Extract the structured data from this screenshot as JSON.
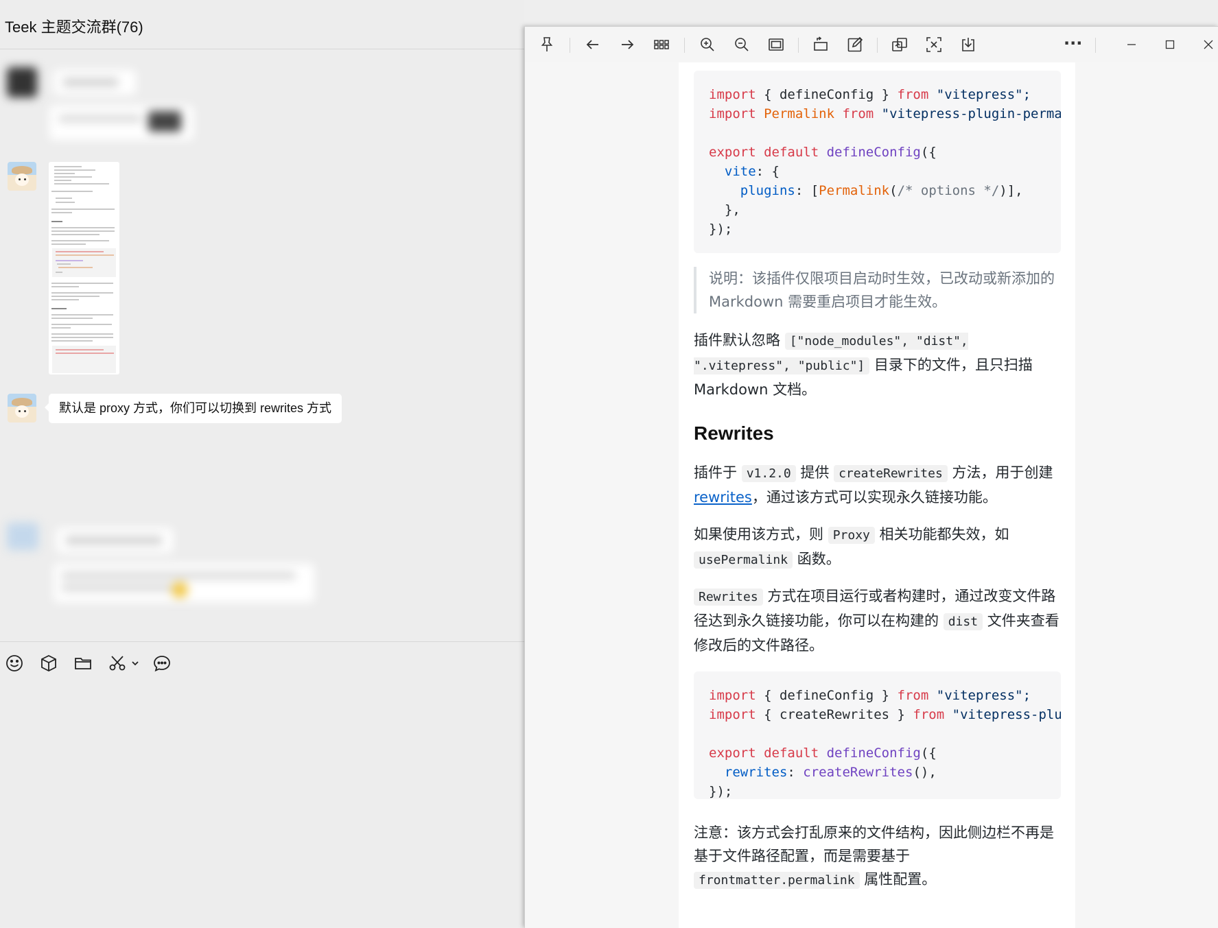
{
  "chat": {
    "title": "Teek 主题交流群(76)",
    "message_text": "默认是 proxy 方式，你们可以切换到 rewrites 方式",
    "toolbar": {
      "icons": [
        "emoji-icon",
        "box-icon",
        "folder-icon",
        "scissors-icon",
        "chevron-down-icon",
        "chat-bubble-icon"
      ]
    }
  },
  "viewer": {
    "toolbar_icons": [
      "pin-icon",
      "arrow-left-icon",
      "arrow-right-icon",
      "grid-icon",
      "zoom-in-icon",
      "zoom-out-icon",
      "fit-screen-icon",
      "rotate-icon",
      "edit-icon",
      "copy-icon",
      "scan-icon",
      "download-icon",
      "more-icon",
      "minimize-icon",
      "maximize-icon",
      "close-icon"
    ],
    "more_glyph": "···",
    "doc": {
      "code1": {
        "l1": {
          "kw": "import",
          "a": " { defineConfig } ",
          "kw2": "from",
          "s": " \"vitepress\";"
        },
        "l2": {
          "kw": "import",
          "cls": " Permalink",
          "kw2": " from",
          "s": " \"vitepress-plugin-perma"
        },
        "l3": {
          "kw": "export default",
          "fn": " defineConfig",
          "rest": "({"
        },
        "l4": {
          "prop": "  vite",
          "rest": ": {"
        },
        "l5": {
          "prop": "    plugins",
          "a": ": [",
          "cls": "Permalink",
          "b": "(",
          "cm": "/* options */",
          "c": ")],"
        },
        "l6": "  },",
        "l7": "});"
      },
      "note": "说明：该插件仅限项目启动时生效，已改动或新添加的 Markdown 需要重启项目才能生效。",
      "p1": {
        "a": "插件默认忽略 ",
        "code": "[\"node_modules\", \"dist\", \".vitepress\", \"public\"]",
        "b": " 目录下的文件，且只扫描 Markdown 文档。"
      },
      "h2": "Rewrites",
      "p2": {
        "a": "插件于 ",
        "code1": "v1.2.0",
        "b": " 提供 ",
        "code2": "createRewrites",
        "c": " 方法，用于创建 ",
        "link": "rewrites",
        "d": "，通过该方式可以实现永久链接功能。"
      },
      "p3": {
        "a": "如果使用该方式，则 ",
        "code1": "Proxy",
        "b": " 相关功能都失效，如 ",
        "code2": "usePermalink",
        "c": " 函数。"
      },
      "p4": {
        "code1": "Rewrites",
        "a": " 方式在项目运行或者构建时，通过改变文件路径达到永久链接功能，你可以在构建的 ",
        "code2": "dist",
        "b": " 文件夹查看修改后的文件路径。"
      },
      "code2": {
        "l1": {
          "kw": "import",
          "a": " { defineConfig } ",
          "kw2": "from",
          "s": " \"vitepress\";"
        },
        "l2": {
          "kw": "import",
          "a": " { createRewrites } ",
          "kw2": "from",
          "s": " \"vitepress-plu"
        },
        "l3": {
          "kw": "export default",
          "fn": " defineConfig",
          "rest": "({"
        },
        "l4": {
          "prop": "  rewrites",
          "a": ": ",
          "fn": "createRewrites",
          "b": "(),"
        },
        "l5": "});"
      },
      "p5": {
        "a": "注意：该方式会打乱原来的文件结构，因此侧边栏不再是基于文件路径配置，而是需要基于 ",
        "code": "frontmatter.permalink",
        "b": " 属性配置。"
      }
    }
  },
  "colors": {
    "keyword": "#d73a49",
    "string": "#032f62",
    "function": "#6f42c1",
    "class": "#e36209",
    "property": "#005cc5",
    "link": "#0a62c9"
  }
}
